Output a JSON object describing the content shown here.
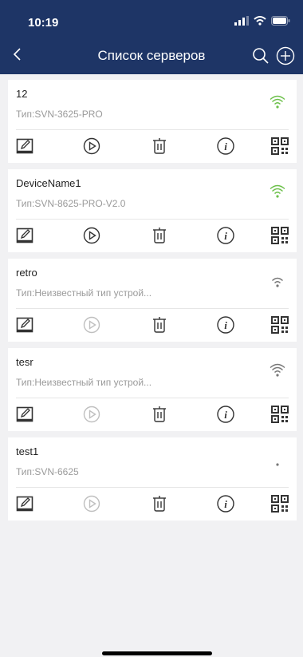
{
  "status_bar": {
    "time": "10:19"
  },
  "nav": {
    "title": "Список серверов"
  },
  "servers": [
    {
      "name": "12",
      "type": "Тип:SVN-3625-PRO",
      "signal": "strong-green",
      "play_enabled": true
    },
    {
      "name": "DeviceName1",
      "type": "Тип:SVN-8625-PRO-V2.0",
      "signal": "strong-green",
      "play_enabled": true
    },
    {
      "name": "retro",
      "type": "Тип:Неизвестный тип устрой...",
      "signal": "medium-gray",
      "play_enabled": false
    },
    {
      "name": "tesr",
      "type": "Тип:Неизвестный тип устрой...",
      "signal": "strong-gray",
      "play_enabled": false
    },
    {
      "name": "test1",
      "type": "Тип:SVN-6625",
      "signal": "weak-gray",
      "play_enabled": false
    }
  ],
  "colors": {
    "header_bg": "#1e3566",
    "signal_green": "#6cc04a",
    "signal_gray": "#777777",
    "icon_dark": "#333333",
    "icon_disabled": "#bfbfbf"
  },
  "icons": [
    "back-icon",
    "search-icon",
    "add-icon",
    "edit-icon",
    "play-icon",
    "delete-icon",
    "info-icon",
    "qr-code-icon",
    "wifi-signal-icon"
  ]
}
